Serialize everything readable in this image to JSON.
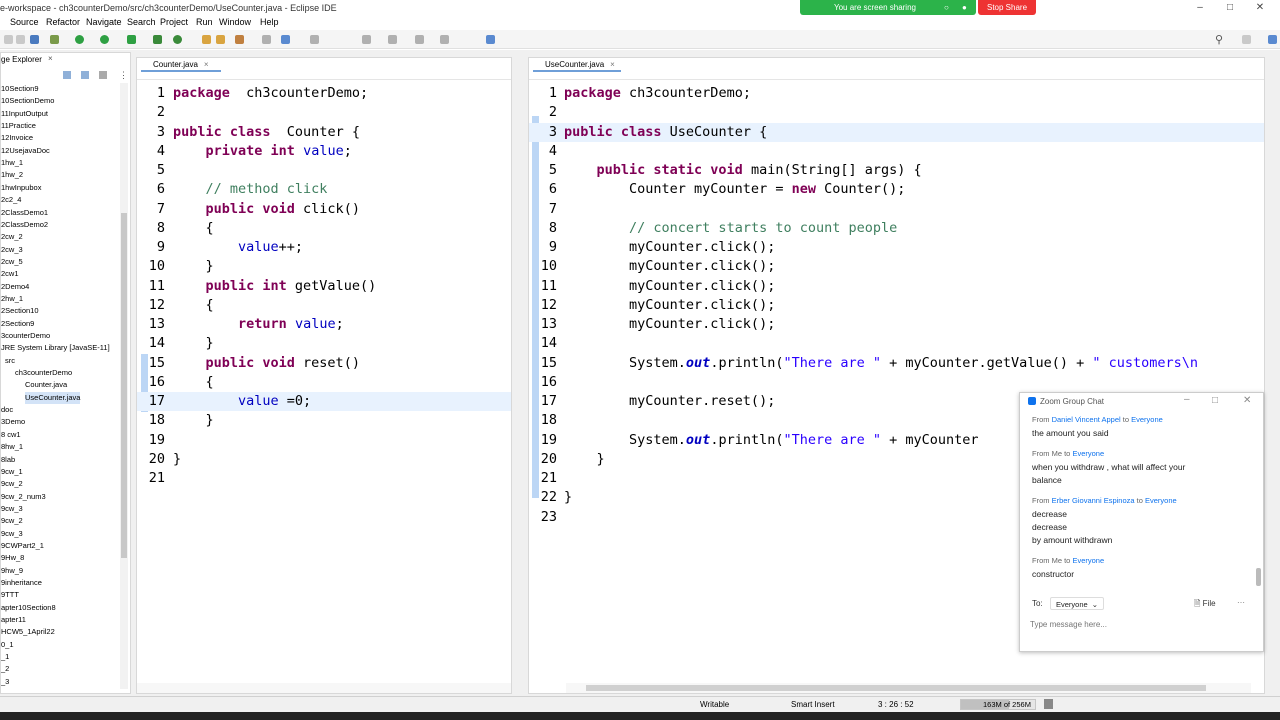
{
  "window": {
    "title": "e-workspace - ch3counterDemo/src/ch3counterDemo/UseCounter.java - Eclipse IDE"
  },
  "screen_share": {
    "status": "You are screen sharing",
    "stop_label": "Stop Share",
    "color": "#2cb34a",
    "stop_color": "#e33333"
  },
  "menu": [
    "Source",
    "Refactor",
    "Navigate",
    "Search",
    "Project",
    "Run",
    "Window",
    "Help"
  ],
  "explorer": {
    "tab": "ge Explorer",
    "items": [
      "10Section9",
      "10SectionDemo",
      "11InputOutput",
      "11Practice",
      "12Invoice",
      "12UsejavaDoc",
      "1hw_1",
      "1hw_2",
      "1hwInpubox",
      "2c2_4",
      "2ClassDemo1",
      "2ClassDemo2",
      "2cw_2",
      "2cw_3",
      "2cw_5",
      "2cw1",
      "2Demo4",
      "2hw_1",
      "2Section10",
      "2Section9",
      "3counterDemo",
      "JRE System Library [JavaSE-11]",
      "src",
      "ch3counterDemo",
      "Counter.java",
      "UseCounter.java",
      "doc",
      "3Demo",
      "8 cw1",
      "8hw_1",
      "8lab",
      "9cw_1",
      "9cw_2",
      "9cw_2_num3",
      "9cw_3",
      "9cw_2",
      "9cw_3",
      "9CWPart2_1",
      "9Hw_8",
      "9hw_9",
      "9inheritance",
      "9TTT",
      "apter10Section8",
      "apter11",
      "HCW5_1April22",
      "0_1",
      "_1",
      "_2",
      "_3"
    ]
  },
  "left_editor": {
    "tab": "Counter.java",
    "lines": [
      {
        "n": "1",
        "parts": [
          [
            "kw",
            "package"
          ],
          [
            "",
            "  ch3counterDemo;"
          ]
        ]
      },
      {
        "n": "2",
        "parts": []
      },
      {
        "n": "3",
        "parts": [
          [
            "kw",
            "public class"
          ],
          [
            "",
            "  Counter {"
          ]
        ]
      },
      {
        "n": "4",
        "parts": [
          [
            "",
            "    "
          ],
          [
            "kw",
            "private int"
          ],
          [
            "",
            " "
          ],
          [
            "fd",
            "value"
          ],
          [
            "",
            ";"
          ]
        ]
      },
      {
        "n": "5",
        "parts": []
      },
      {
        "n": "6",
        "parts": [
          [
            "",
            "    "
          ],
          [
            "cm",
            "// method click"
          ]
        ]
      },
      {
        "n": "7",
        "parts": [
          [
            "",
            "    "
          ],
          [
            "kw",
            "public void"
          ],
          [
            "",
            " click()"
          ]
        ]
      },
      {
        "n": "8",
        "parts": [
          [
            "",
            "    {"
          ]
        ]
      },
      {
        "n": "9",
        "parts": [
          [
            "",
            "        "
          ],
          [
            "fd",
            "value"
          ],
          [
            "",
            "++;"
          ]
        ]
      },
      {
        "n": "10",
        "parts": [
          [
            "",
            "    }"
          ]
        ]
      },
      {
        "n": "11",
        "parts": [
          [
            "",
            "    "
          ],
          [
            "kw",
            "public int"
          ],
          [
            "",
            " getValue()"
          ]
        ]
      },
      {
        "n": "12",
        "parts": [
          [
            "",
            "    {"
          ]
        ]
      },
      {
        "n": "13",
        "parts": [
          [
            "",
            "        "
          ],
          [
            "kw",
            "return"
          ],
          [
            "",
            " "
          ],
          [
            "fd",
            "value"
          ],
          [
            "",
            ";"
          ]
        ]
      },
      {
        "n": "14",
        "parts": [
          [
            "",
            "    }"
          ]
        ]
      },
      {
        "n": "15",
        "parts": [
          [
            "",
            "    "
          ],
          [
            "kw",
            "public void"
          ],
          [
            "",
            " reset()"
          ]
        ]
      },
      {
        "n": "16",
        "parts": [
          [
            "",
            "    {"
          ]
        ]
      },
      {
        "n": "17",
        "parts": [
          [
            "",
            "        "
          ],
          [
            "fd",
            "value"
          ],
          [
            "",
            " =0;"
          ]
        ]
      },
      {
        "n": "18",
        "parts": [
          [
            "",
            "    }"
          ]
        ]
      },
      {
        "n": "19",
        "parts": []
      },
      {
        "n": "20",
        "parts": [
          [
            "",
            "}"
          ]
        ]
      },
      {
        "n": "21",
        "parts": []
      }
    ]
  },
  "right_editor": {
    "tab": "UseCounter.java",
    "lines": [
      {
        "n": "1",
        "parts": [
          [
            "kw",
            "package"
          ],
          [
            "",
            " ch3counterDemo;"
          ]
        ]
      },
      {
        "n": "2",
        "parts": []
      },
      {
        "n": "3",
        "parts": [
          [
            "kw",
            "public class"
          ],
          [
            "",
            " UseCounter {"
          ]
        ]
      },
      {
        "n": "4",
        "parts": []
      },
      {
        "n": "5",
        "parts": [
          [
            "",
            "    "
          ],
          [
            "kw",
            "public static void"
          ],
          [
            "",
            " main(String[] args) {"
          ]
        ]
      },
      {
        "n": "6",
        "parts": [
          [
            "",
            "        Counter myCounter = "
          ],
          [
            "kw",
            "new"
          ],
          [
            "",
            " Counter();"
          ]
        ]
      },
      {
        "n": "7",
        "parts": []
      },
      {
        "n": "8",
        "parts": [
          [
            "",
            "        "
          ],
          [
            "cm",
            "// concert starts to count people"
          ]
        ]
      },
      {
        "n": "9",
        "parts": [
          [
            "",
            "        myCounter.click();"
          ]
        ]
      },
      {
        "n": "10",
        "parts": [
          [
            "",
            "        myCounter.click();"
          ]
        ]
      },
      {
        "n": "11",
        "parts": [
          [
            "",
            "        myCounter.click();"
          ]
        ]
      },
      {
        "n": "12",
        "parts": [
          [
            "",
            "        myCounter.click();"
          ]
        ]
      },
      {
        "n": "13",
        "parts": [
          [
            "",
            "        myCounter.click();"
          ]
        ]
      },
      {
        "n": "14",
        "parts": []
      },
      {
        "n": "15",
        "parts": [
          [
            "",
            "        System."
          ],
          [
            "it",
            "out"
          ],
          [
            "",
            ".println("
          ],
          [
            "st",
            "\"There are \""
          ],
          [
            "",
            " + myCounter.getValue() + "
          ],
          [
            "st",
            "\" customers\\n"
          ]
        ]
      },
      {
        "n": "16",
        "parts": []
      },
      {
        "n": "17",
        "parts": [
          [
            "",
            "        myCounter.reset();"
          ]
        ]
      },
      {
        "n": "18",
        "parts": []
      },
      {
        "n": "19",
        "parts": [
          [
            "",
            "        System."
          ],
          [
            "it",
            "out"
          ],
          [
            "",
            ".println("
          ],
          [
            "st",
            "\"There are \""
          ],
          [
            "",
            " + myCounter"
          ]
        ]
      },
      {
        "n": "20",
        "parts": [
          [
            "",
            "    }"
          ]
        ]
      },
      {
        "n": "21",
        "parts": []
      },
      {
        "n": "22",
        "parts": [
          [
            "",
            "}"
          ]
        ]
      },
      {
        "n": "23",
        "parts": []
      }
    ]
  },
  "status": {
    "writable": "Writable",
    "insert": "Smart Insert",
    "position": "3 : 26 : 52",
    "memory": "163M of 256M"
  },
  "zoom_chat": {
    "title": "Zoom Group Chat",
    "messages": [
      {
        "from": "Daniel Vincent Appel",
        "to": "Everyone",
        "lines": [
          "the amount you said"
        ]
      },
      {
        "from": "Me",
        "to": "Everyone",
        "lines": [
          "when you withdraw , what  will affect your",
          "balance"
        ]
      },
      {
        "from": "Erber Giovanni Espinoza",
        "to": "Everyone",
        "lines": [
          "decrease",
          "decrease",
          "by amount withdrawn"
        ]
      },
      {
        "from": "Me",
        "to": "Everyone",
        "lines": [
          "constructor"
        ]
      }
    ],
    "to_label": "To:",
    "to_value": "Everyone",
    "file_label": "File",
    "placeholder": "Type message here..."
  }
}
